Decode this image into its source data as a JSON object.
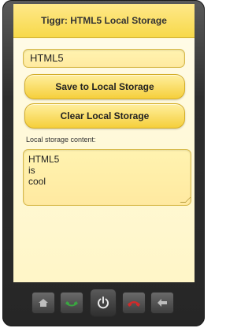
{
  "app": {
    "title": "Tiggr: HTML5 Local Storage"
  },
  "form": {
    "input_value": "HTML5",
    "save_label": "Save to Local Storage",
    "clear_label": "Clear Local Storage",
    "content_label": "Local storage content:",
    "content_lines": [
      "HTML5",
      "is",
      "cool"
    ]
  },
  "device_keys": [
    {
      "name": "home-icon"
    },
    {
      "name": "call-icon",
      "color": "#3aa541"
    },
    {
      "name": "power-icon"
    },
    {
      "name": "end-call-icon",
      "color": "#d12a2a"
    },
    {
      "name": "back-arrow-icon"
    }
  ],
  "colors": {
    "accent": "#f5cf3b",
    "background": "#fff6c7",
    "device": "#2e2e2e"
  }
}
